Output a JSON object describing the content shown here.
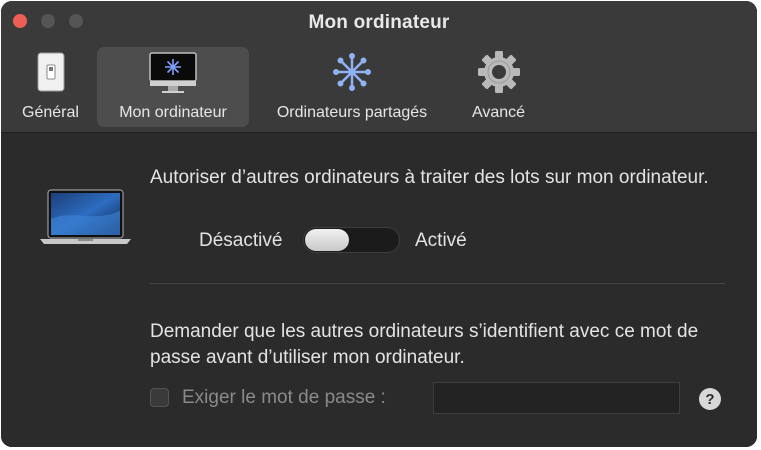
{
  "window": {
    "title": "Mon ordinateur"
  },
  "toolbar": {
    "tabs": [
      {
        "label": "Général",
        "icon": "general-switch-icon"
      },
      {
        "label": "Mon ordinateur",
        "icon": "imac-icon",
        "selected": true
      },
      {
        "label": "Ordinateurs partagés",
        "icon": "shared-computers-icon"
      },
      {
        "label": "Avancé",
        "icon": "gear-icon"
      }
    ]
  },
  "main": {
    "allow_text": "Autoriser d’autres ordinateurs à traiter des lots sur mon ordinateur.",
    "toggle": {
      "off_label": "Désactivé",
      "on_label": "Activé",
      "state": "off"
    },
    "password_text": "Demander que les autres ordinateurs s’identifient avec ce mot de passe avant d’utiliser mon ordinateur.",
    "require_password_label": "Exiger le mot de passe :",
    "require_password_checked": false,
    "password_value": "",
    "help_label": "?"
  },
  "colors": {
    "window_bg": "#2b2b2b",
    "toolbar_bg": "#3a3a3a",
    "close": "#ee5e55"
  }
}
